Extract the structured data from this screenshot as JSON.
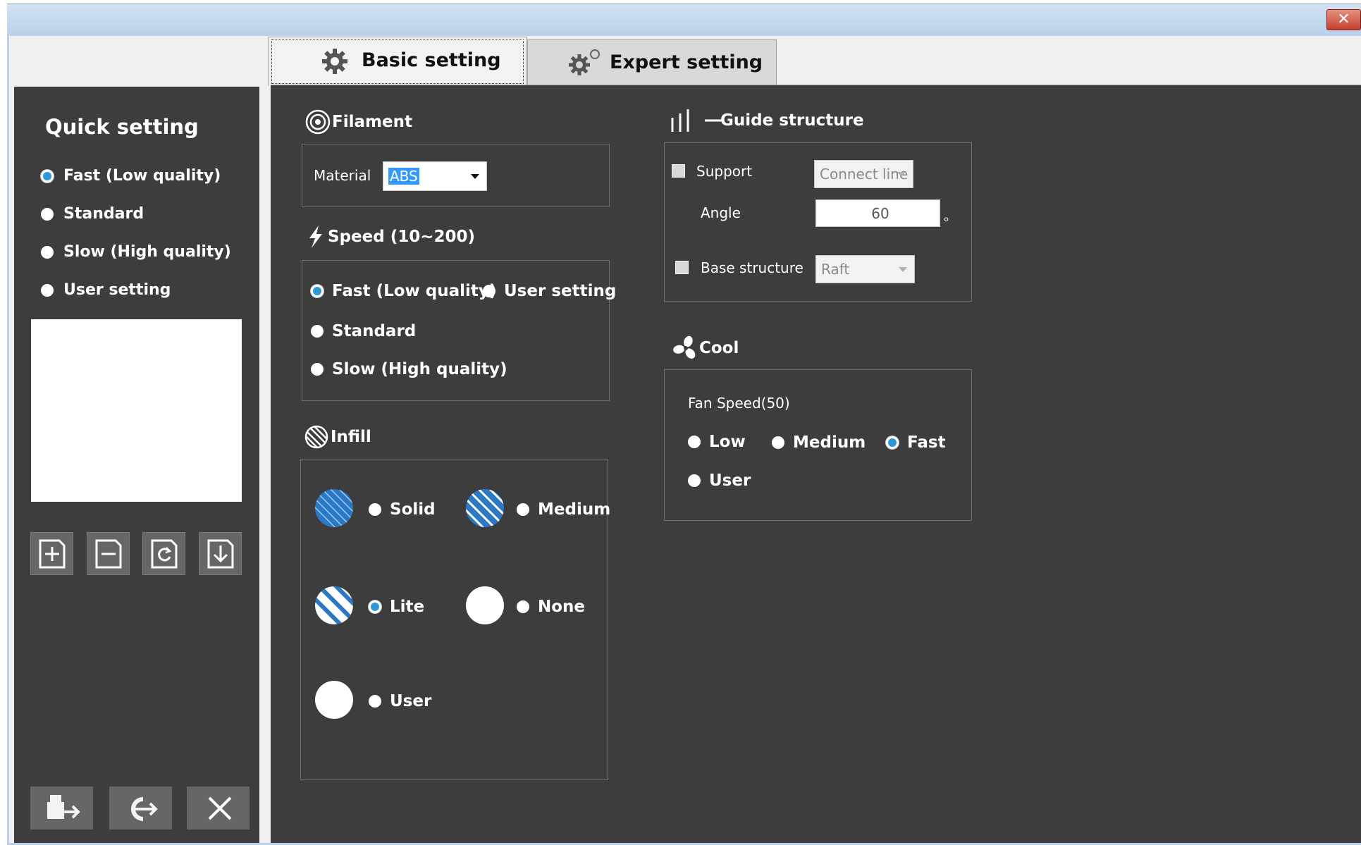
{
  "window": {
    "close_label": "✕"
  },
  "tabs": [
    {
      "label": "Basic setting",
      "icon": "gear-icon",
      "active": true
    },
    {
      "label": "Expert setting",
      "icon": "gears-icon",
      "active": false
    }
  ],
  "sidebar": {
    "title": "Quick setting",
    "options": [
      {
        "label": "Fast (Low quality)",
        "selected": true
      },
      {
        "label": "Standard",
        "selected": false
      },
      {
        "label": "Slow (High quality)",
        "selected": false
      },
      {
        "label": "User setting",
        "selected": false
      }
    ],
    "preset_buttons": [
      "add-preset-icon",
      "remove-preset-icon",
      "refresh-preset-icon",
      "import-preset-icon"
    ],
    "bottom_buttons": [
      "print-export-icon",
      "export-icon",
      "close-icon"
    ]
  },
  "filament": {
    "title": "Filament",
    "material_label": "Material",
    "material_value": "ABS"
  },
  "speed": {
    "title": "Speed (10~200)",
    "options": [
      {
        "label": "Fast (Low quality)",
        "selected": true
      },
      {
        "label": "User setting",
        "selected": false
      },
      {
        "label": "Standard",
        "selected": false
      },
      {
        "label": "Slow (High quality)",
        "selected": false
      }
    ]
  },
  "infill": {
    "title": "Infill",
    "options": [
      {
        "label": "Solid",
        "selected": false
      },
      {
        "label": "Medium",
        "selected": false
      },
      {
        "label": "Lite",
        "selected": true
      },
      {
        "label": "None",
        "selected": false
      },
      {
        "label": "User",
        "selected": false
      }
    ]
  },
  "guide": {
    "title": "Guide structure",
    "support_label": "Support",
    "support_checked": false,
    "support_type": "Connect line",
    "angle_label": "Angle",
    "angle_value": "60",
    "angle_unit": "。",
    "base_label": "Base structure",
    "base_checked": false,
    "base_type": "Raft"
  },
  "cool": {
    "title": "Cool",
    "fan_label": "Fan Speed(50)",
    "options": [
      {
        "label": "Low",
        "selected": false
      },
      {
        "label": "Medium",
        "selected": false
      },
      {
        "label": "Fast",
        "selected": true
      },
      {
        "label": "User",
        "selected": false
      }
    ]
  },
  "colors": {
    "panel": "#3d3d3d",
    "accent": "#2f98da",
    "hatch_blue": "#2a78c6"
  }
}
